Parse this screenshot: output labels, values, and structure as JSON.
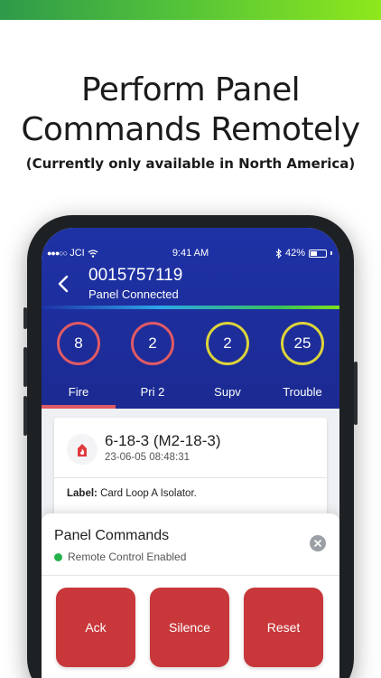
{
  "promo": {
    "headline_line1": "Perform Panel",
    "headline_line2": "Commands Remotely",
    "subline": "(Currently only available in North America)"
  },
  "status_bar": {
    "carrier": "JCI",
    "time": "9:41 AM",
    "battery": "42%",
    "battery_level": 0.42
  },
  "header": {
    "panel_id": "0015757119",
    "panel_status": "Panel Connected"
  },
  "counts": [
    {
      "label": "Fire",
      "value": "8",
      "color": "#e05a64"
    },
    {
      "label": "Pri 2",
      "value": "2",
      "color": "#e05a64"
    },
    {
      "label": "Supv",
      "value": "2",
      "color": "#dcd43a"
    },
    {
      "label": "Trouble",
      "value": "25",
      "color": "#dcd43a"
    }
  ],
  "selected_tab": "Fire",
  "event": {
    "title": "6-18-3 (M2-18-3)",
    "timestamp": "23-06-05 08:48:31",
    "label_key": "Label:",
    "label_value": "Card Loop A Isolator."
  },
  "commands_sheet": {
    "title": "Panel Commands",
    "status": "Remote Control Enabled",
    "buttons": [
      "Ack",
      "Silence",
      "Reset"
    ]
  },
  "colors": {
    "header_blue": "#1e32a6",
    "command_red": "#c8373a",
    "status_green": "#26b24b"
  }
}
